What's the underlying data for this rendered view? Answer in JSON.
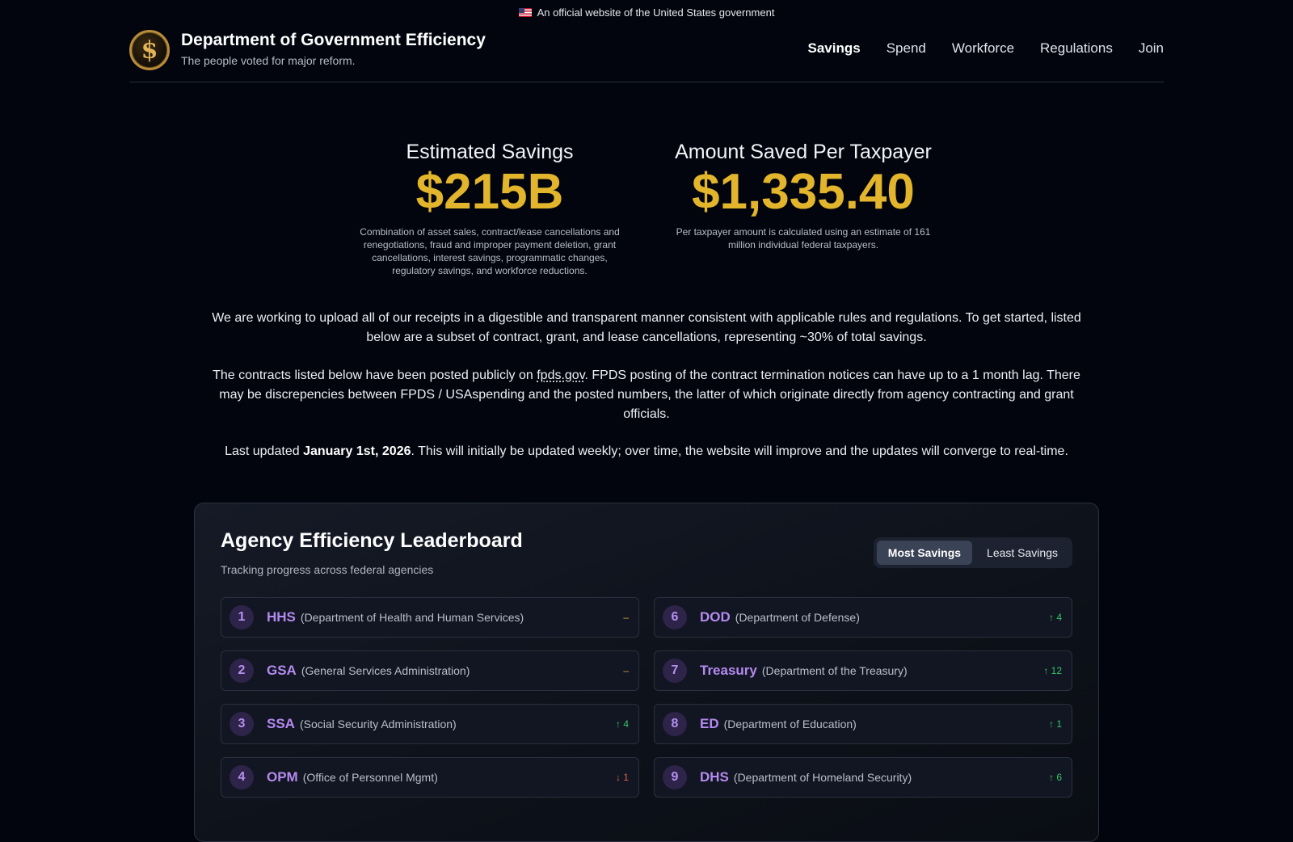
{
  "banner": {
    "text": "An official website of the United States government"
  },
  "header": {
    "title": "Department of Government Efficiency",
    "tagline": "The people voted for major reform.",
    "logo_glyph": "$",
    "nav": [
      {
        "label": "Savings",
        "active": true
      },
      {
        "label": "Spend",
        "active": false
      },
      {
        "label": "Workforce",
        "active": false
      },
      {
        "label": "Regulations",
        "active": false
      },
      {
        "label": "Join",
        "active": false
      }
    ]
  },
  "stats": {
    "savings": {
      "label": "Estimated Savings",
      "value": "$215B",
      "note": "Combination of asset sales, contract/lease cancellations and renegotiations, fraud and improper payment deletion, grant cancellations, interest savings, programmatic changes, regulatory savings, and workforce reductions."
    },
    "per_taxpayer": {
      "label": "Amount Saved Per Taxpayer",
      "value": "$1,335.40",
      "note": "Per taxpayer amount is calculated using an estimate of 161 million individual federal taxpayers."
    }
  },
  "intro": {
    "p1": "We are working to upload all of our receipts in a digestible and transparent manner consistent with applicable rules and regulations. To get started, listed below are a subset of contract, grant, and lease cancellations, representing ~30% of total savings.",
    "p2_before": "The contracts listed below have been posted publicly on ",
    "p2_link": "fpds.gov",
    "p2_after": ". FPDS posting of the contract termination notices can have up to a 1 month lag. There may be discrepencies between FPDS / USAspending and the posted numbers, the latter of which originate directly from agency contracting and grant officials.",
    "p3_before": "Last updated ",
    "p3_date": "January 1st, 2026",
    "p3_after": ". This will initially be updated weekly; over time, the website will improve and the updates will converge to real-time."
  },
  "leaderboard": {
    "title": "Agency Efficiency Leaderboard",
    "subtitle": "Tracking progress across federal agencies",
    "toggle": {
      "most": "Most Savings",
      "least": "Least Savings",
      "selected": "most"
    },
    "colors": {
      "flat": "#d9a83a",
      "up": "#36c46a",
      "down": "#e0624a",
      "accent": "#b58af0"
    },
    "agencies": [
      {
        "rank": "1",
        "abbr": "HHS",
        "name": "(Department of Health and Human Services)",
        "change": "–",
        "direction": "flat"
      },
      {
        "rank": "6",
        "abbr": "DOD",
        "name": "(Department of Defense)",
        "change": "↑ 4",
        "direction": "up"
      },
      {
        "rank": "2",
        "abbr": "GSA",
        "name": "(General Services Administration)",
        "change": "–",
        "direction": "flat"
      },
      {
        "rank": "7",
        "abbr": "Treasury",
        "name": "(Department of the Treasury)",
        "change": "↑ 12",
        "direction": "up"
      },
      {
        "rank": "3",
        "abbr": "SSA",
        "name": "(Social Security Administration)",
        "change": "↑ 4",
        "direction": "up"
      },
      {
        "rank": "8",
        "abbr": "ED",
        "name": "(Department of Education)",
        "change": "↑ 1",
        "direction": "up"
      },
      {
        "rank": "4",
        "abbr": "OPM",
        "name": "(Office of Personnel Mgmt)",
        "change": "↓ 1",
        "direction": "down"
      },
      {
        "rank": "9",
        "abbr": "DHS",
        "name": "(Department of Homeland Security)",
        "change": "↑ 6",
        "direction": "up"
      }
    ]
  }
}
